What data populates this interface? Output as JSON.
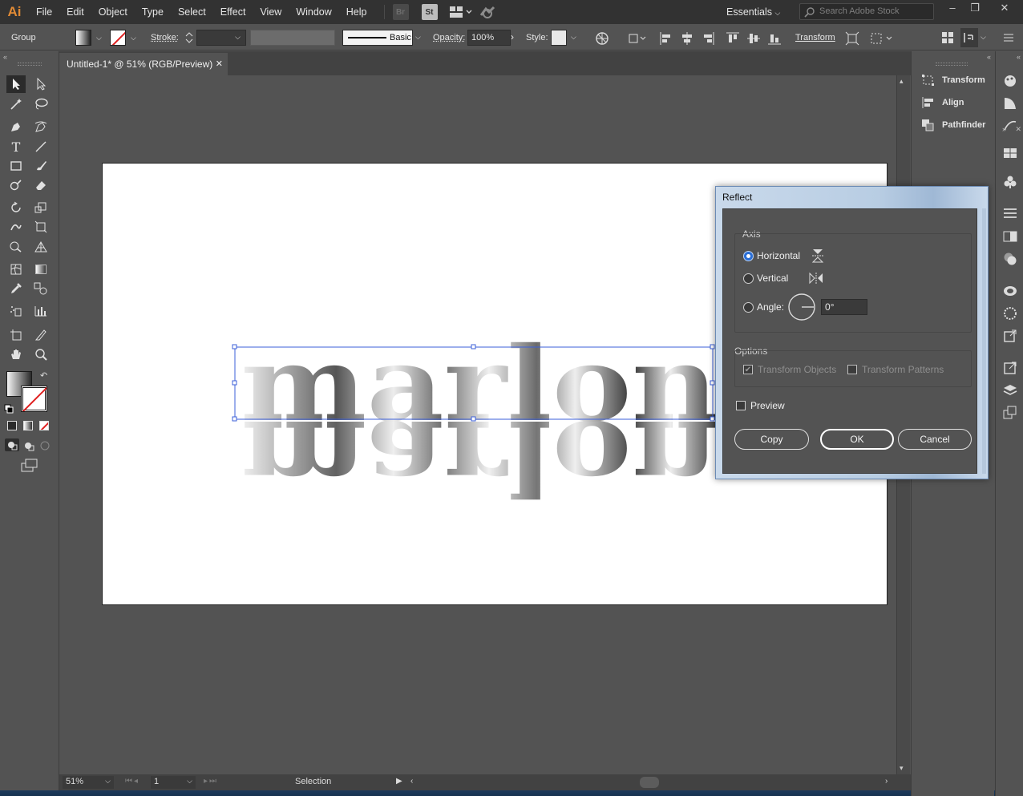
{
  "app": {
    "logo": "Ai",
    "menus": [
      "File",
      "Edit",
      "Object",
      "Type",
      "Select",
      "Effect",
      "View",
      "Window",
      "Help"
    ],
    "bridge": "Br",
    "stock": "St",
    "workspace": "Essentials",
    "search_placeholder": "Search Adobe Stock"
  },
  "control": {
    "selection_type": "Group",
    "stroke_label": "Stroke:",
    "brush_label": "Basic",
    "opacity_label": "Opacity:",
    "opacity_value": "100%",
    "style_label": "Style:",
    "transform_label": "Transform"
  },
  "document": {
    "tab_title": "Untitled-1* @ 51% (RGB/Preview)",
    "close_glyph": "✕"
  },
  "artwork": {
    "text": "marlon"
  },
  "status": {
    "zoom": "51%",
    "artboard_index": "1",
    "current_tool": "Selection"
  },
  "panels": {
    "items": [
      "Transform",
      "Align",
      "Pathfinder"
    ]
  },
  "dialog": {
    "title": "Reflect",
    "axis_label": "Axis",
    "horizontal_label": "Horizontal",
    "vertical_label": "Vertical",
    "angle_label": "Angle:",
    "angle_value": "0°",
    "options_label": "Options",
    "transform_objects_label": "Transform Objects",
    "transform_patterns_label": "Transform Patterns",
    "preview_label": "Preview",
    "copy_label": "Copy",
    "ok_label": "OK",
    "cancel_label": "Cancel",
    "selected_axis": "Horizontal",
    "transform_objects_checked": true,
    "transform_patterns_checked": false,
    "preview_checked": false
  },
  "colors": {
    "accent": "#2b6fd6",
    "selection": "#3b5fd9",
    "app_orange": "#e08a35"
  }
}
